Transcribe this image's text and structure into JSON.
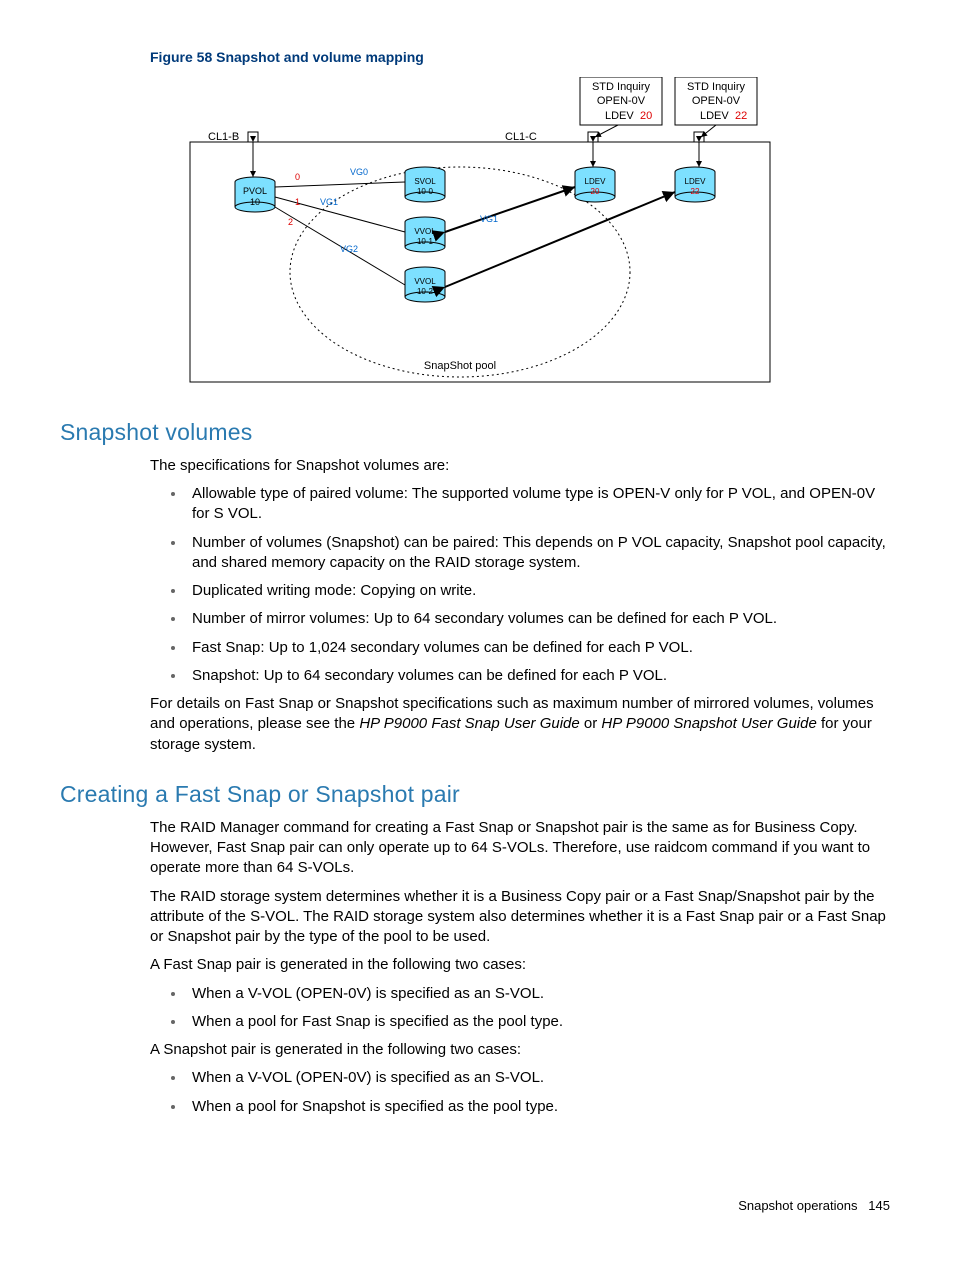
{
  "figure": {
    "caption": "Figure 58 Snapshot and volume mapping",
    "labels": {
      "std1": "STD Inquiry\nOPEN-0V\nLDEV",
      "std1_red": "20",
      "std2": "STD Inquiry\nOPEN-0V\nLDEV",
      "std2_red": "22",
      "cl1b": "CL1-B",
      "cl1c": "CL1-C",
      "pvol": "PVOL\n10",
      "svol": "SVOL\n10-0",
      "vvol1": "VVOL\n10-1",
      "vvol2": "VVOL\n10-2",
      "ldev20": "LDEV\n20",
      "ldev22": "LDEV\n22",
      "pool": "SnapShot pool",
      "vg0": "VG0",
      "vg1": "VG1",
      "vg2": "VG2",
      "vg1b": "VG1"
    }
  },
  "sec1": {
    "title": "Snapshot volumes",
    "intro": "The specifications for Snapshot volumes are:",
    "bullets": [
      "Allowable type of paired volume: The supported volume type is OPEN-V only for P VOL, and OPEN-0V for S VOL.",
      "Number of volumes (Snapshot) can be paired: This depends on P VOL capacity, Snapshot pool capacity, and shared memory capacity on the RAID storage system.",
      "Duplicated writing mode: Copying on write.",
      "Number of mirror volumes: Up to 64 secondary volumes can be defined for each P VOL.",
      "Fast Snap: Up to 1,024 secondary volumes can be defined for each P VOL.",
      "Snapshot: Up to 64 secondary volumes can be defined for each P VOL."
    ],
    "outro_before": "For details on Fast Snap or Snapshot specifications such as maximum number of mirrored volumes, volumes and operations, please see the ",
    "outro_em1": "HP P9000 Fast Snap User Guide",
    "outro_mid": " or ",
    "outro_em2": "HP P9000 Snapshot User Guide",
    "outro_after": " for your storage system."
  },
  "sec2": {
    "title": "Creating a Fast Snap or Snapshot pair",
    "p1": "The RAID Manager command for creating a Fast Snap or Snapshot pair is the same as for Business Copy. However, Fast Snap pair can only operate up to 64 S-VOLs. Therefore, use raidcom command if you want to operate more than 64 S-VOLs.",
    "p2": "The RAID storage system determines whether it is a Business Copy pair or a Fast Snap/Snapshot pair by the attribute of the S-VOL. The RAID storage system also determines whether it is a Fast Snap pair or a Fast Snap or Snapshot pair by the type of the pool to be used.",
    "p3": "A Fast Snap pair is generated in the following two cases:",
    "bullets1": [
      "When a V-VOL (OPEN-0V) is specified as an S-VOL.",
      "When a pool for Fast Snap is specified as the pool type."
    ],
    "p4": "A Snapshot pair is generated in the following two cases:",
    "bullets2": [
      "When a V-VOL (OPEN-0V) is specified as an S-VOL.",
      "When a pool for Snapshot is specified as the pool type."
    ]
  },
  "footer": {
    "section": "Snapshot operations",
    "page": "145"
  }
}
